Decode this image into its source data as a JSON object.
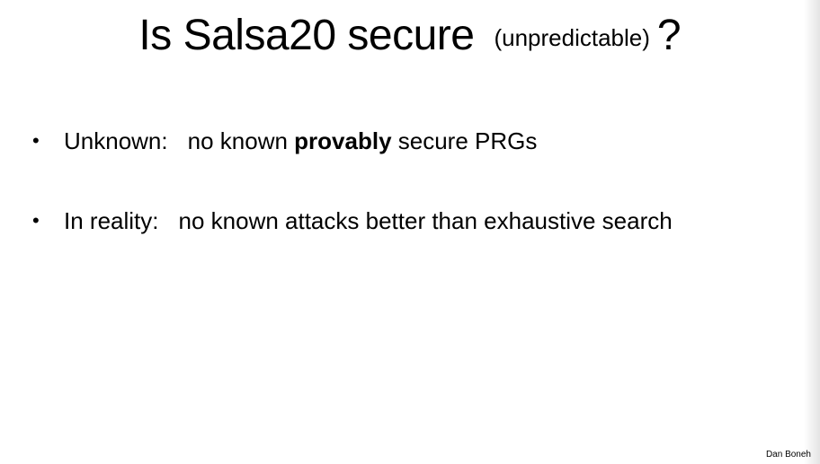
{
  "slide": {
    "title": {
      "main": "Is Salsa20 secure",
      "sub": "(unpredictable)",
      "question_mark": "?"
    },
    "bullets": [
      {
        "marker": "•",
        "label": "Unknown:",
        "text_before": "no known ",
        "bold": "provably",
        "text_after": " secure PRGs"
      },
      {
        "marker": "•",
        "label": "In reality:",
        "text": "no known attacks better than exhaustive search"
      }
    ],
    "footer": "Dan Boneh"
  }
}
